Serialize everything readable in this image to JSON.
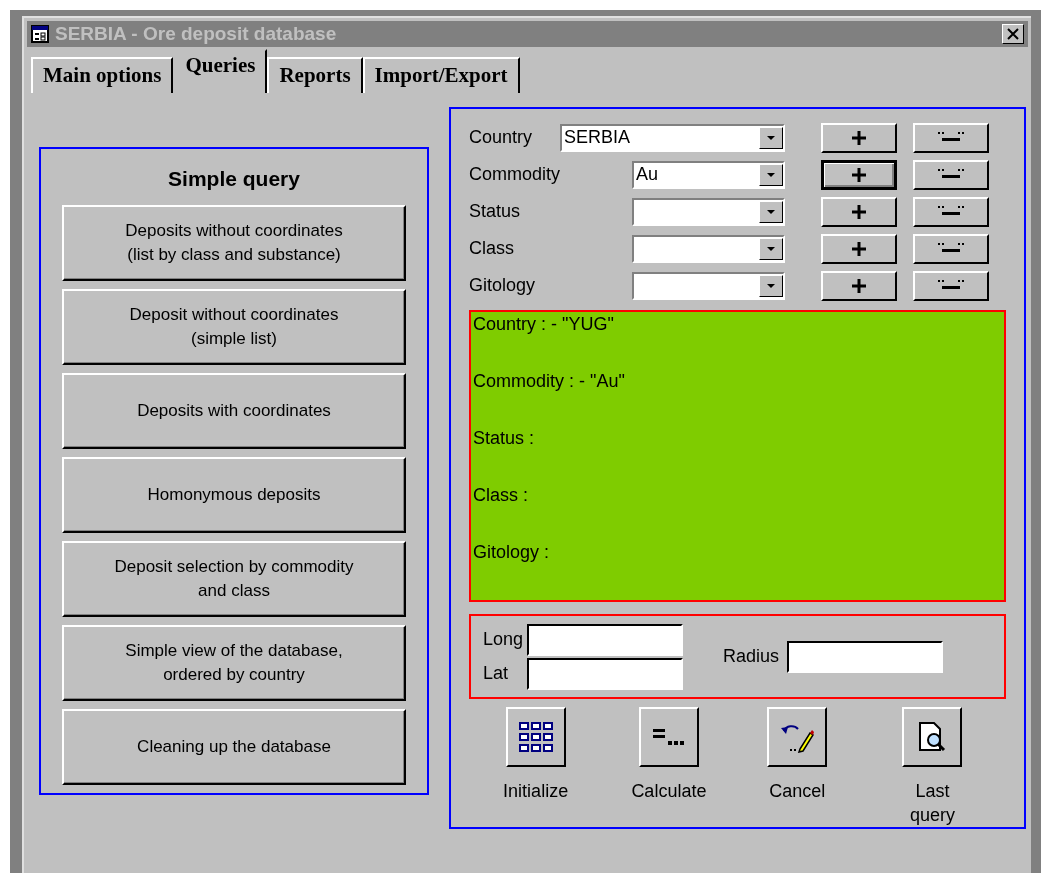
{
  "window": {
    "title": "SERBIA - Ore deposit database"
  },
  "tabs": [
    {
      "label": "Main options",
      "selected": false
    },
    {
      "label": "Queries",
      "selected": true
    },
    {
      "label": "Reports",
      "selected": false
    },
    {
      "label": "Import/Export",
      "selected": false
    }
  ],
  "simple_query": {
    "title": "Simple query",
    "buttons": [
      [
        "Deposits without coordinates",
        "(list by class and substance)"
      ],
      [
        "Deposit without coordinates",
        "(simple list)"
      ],
      [
        "Deposits with coordinates"
      ],
      [
        "Homonymous deposits"
      ],
      [
        "Deposit selection by commodity",
        "and class"
      ],
      [
        "Simple view of the database,",
        "ordered by country"
      ],
      [
        "Cleaning up the database"
      ]
    ]
  },
  "filters": [
    {
      "label": "Country",
      "value": "SERBIA",
      "wide": true,
      "plus_focused": false
    },
    {
      "label": "Commodity",
      "value": "Au",
      "wide": false,
      "plus_focused": true
    },
    {
      "label": "Status",
      "wide": false,
      "plus_focused": false
    },
    {
      "label": "Class",
      "wide": false,
      "plus_focused": false
    },
    {
      "label": "Gitology",
      "wide": false,
      "plus_focused": false
    }
  ],
  "summary": [
    "Country : - \"YUG\"",
    "Commodity : - \"Au\"",
    "Status :",
    "Class :",
    "Gitology :"
  ],
  "coordinates": {
    "long_label": "Long",
    "lat_label": "Lat",
    "radius_label": "Radius"
  },
  "actions": [
    {
      "kind": "grid",
      "label": [
        "Initialize"
      ]
    },
    {
      "kind": "equals",
      "label": [
        "Calculate"
      ]
    },
    {
      "kind": "undo",
      "label": [
        "Cancel"
      ]
    },
    {
      "kind": "preview",
      "label": [
        "Last",
        "query"
      ]
    }
  ]
}
